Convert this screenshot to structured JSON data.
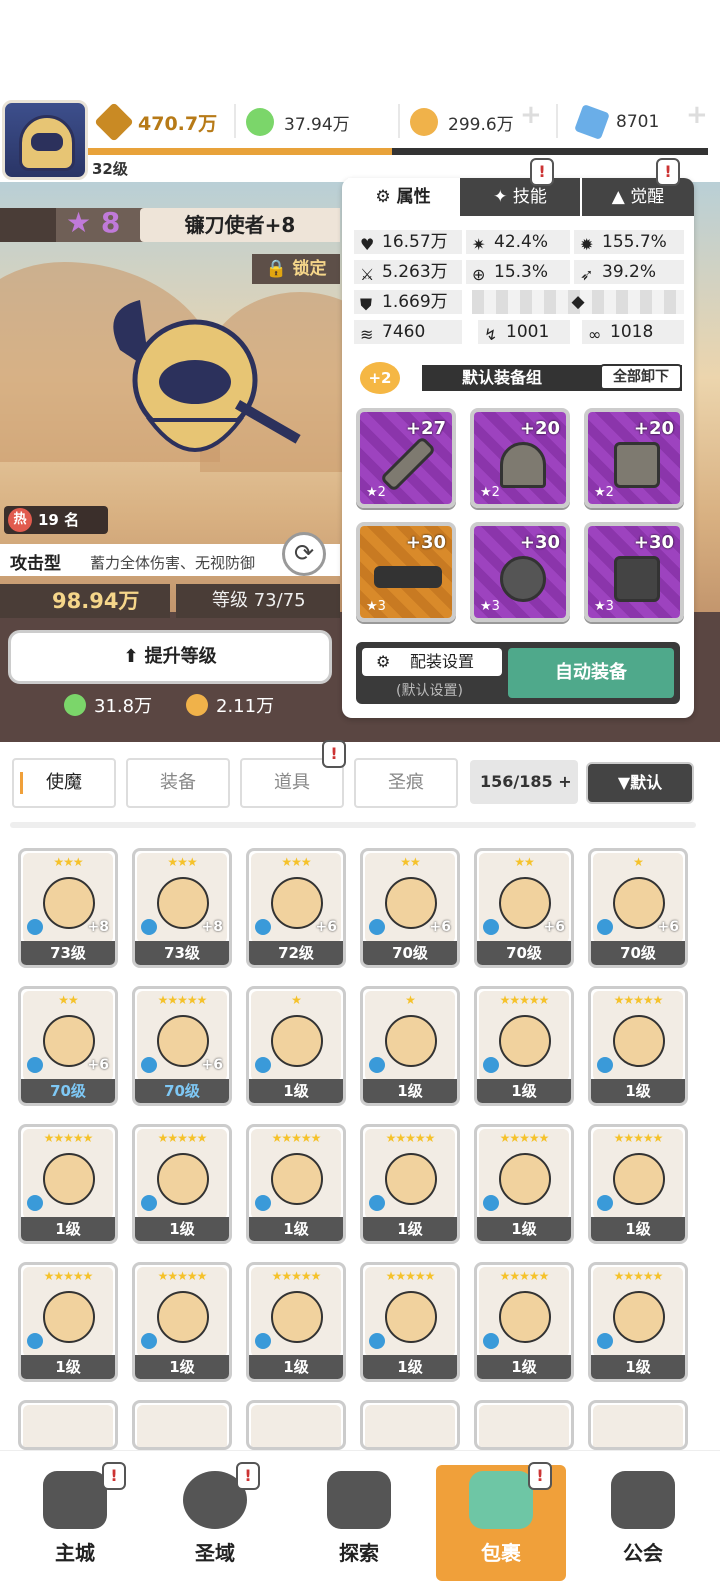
{
  "header": {
    "player_level": "32级",
    "xp_progress": 0.49,
    "resources": [
      {
        "icon": "sword-power-icon",
        "value": "470.7万",
        "color": "#c98a24"
      },
      {
        "icon": "green-orb-icon",
        "value": "37.94万",
        "color": "#7bd66a"
      },
      {
        "icon": "gold-coin-icon",
        "value": "299.6万",
        "color": "#f0b24a"
      },
      {
        "icon": "blue-gem-icon",
        "value": "8701",
        "color": "#6aaee8"
      }
    ]
  },
  "character": {
    "stars": "8",
    "name": "镰刀使者+8",
    "lock_label": "锁定",
    "heat_badge": "热",
    "heat_rank": "19 名",
    "type_label": "攻击型",
    "type_desc": "蓄力全体伤害、无视防御",
    "power": "98.94万",
    "level_text": "等级 73/75",
    "upgrade_label": "提升等级",
    "cost_green": "31.8万",
    "cost_gold": "2.11万"
  },
  "panel": {
    "tabs": [
      {
        "label": "属性",
        "icon": "attribute-icon"
      },
      {
        "label": "技能",
        "icon": "skill-icon"
      },
      {
        "label": "觉醒",
        "icon": "awaken-icon"
      }
    ],
    "stats": [
      {
        "icon": "heart-icon",
        "value": "16.57万"
      },
      {
        "icon": "crit-icon",
        "value": "42.4%"
      },
      {
        "icon": "burst-icon",
        "value": "155.7%"
      },
      {
        "icon": "attack-icon",
        "value": "5.263万"
      },
      {
        "icon": "accuracy-icon",
        "value": "15.3%"
      },
      {
        "icon": "dodge-icon",
        "value": "39.2%"
      },
      {
        "icon": "defense-icon",
        "value": "1.669万"
      },
      {
        "icon": "speed-icon",
        "value": "7460"
      },
      {
        "icon": "pierce-icon",
        "value": "1001"
      },
      {
        "icon": "resist-icon",
        "value": "1018"
      }
    ],
    "equip_badge": "+2",
    "equip_set": "默认装备组",
    "unload_all": "全部卸下",
    "equipment": [
      {
        "plus": "+27",
        "stars": "★2",
        "icon": "sword-item-icon",
        "color": "#9d43bf"
      },
      {
        "plus": "+20",
        "stars": "★2",
        "icon": "helmet-item-icon",
        "color": "#9d43bf"
      },
      {
        "plus": "+20",
        "stars": "★2",
        "icon": "armor-item-icon",
        "color": "#9d43bf"
      },
      {
        "plus": "+30",
        "stars": "★3",
        "icon": "belt-item-icon",
        "color": "#d98a2a"
      },
      {
        "plus": "+30",
        "stars": "★3",
        "icon": "necklace-item-icon",
        "color": "#9d43bf"
      },
      {
        "plus": "+30",
        "stars": "★3",
        "icon": "boots-item-icon",
        "color": "#9d43bf"
      }
    ],
    "config_label": "配装设置",
    "config_sub": "(默认设置)",
    "auto_equip": "自动装备"
  },
  "inventory": {
    "tabs": [
      "使魔",
      "装备",
      "道具",
      "圣痕"
    ],
    "count": "156/185",
    "sort_label": "▼默认",
    "cards": [
      {
        "level": "73级",
        "plus": "+8",
        "stars": "★★★",
        "blue": false
      },
      {
        "level": "73级",
        "plus": "+8",
        "stars": "★★★",
        "blue": false
      },
      {
        "level": "72级",
        "plus": "+6",
        "stars": "★★★",
        "blue": false
      },
      {
        "level": "70级",
        "plus": "+6",
        "stars": "★★",
        "blue": false
      },
      {
        "level": "70级",
        "plus": "+6",
        "stars": "★★",
        "blue": false
      },
      {
        "level": "70级",
        "plus": "+6",
        "stars": "★",
        "blue": false
      },
      {
        "level": "70级",
        "plus": "+6",
        "stars": "★★",
        "blue": true
      },
      {
        "level": "70级",
        "plus": "+6",
        "stars": "★★★★★",
        "blue": true
      },
      {
        "level": "1级",
        "plus": "",
        "stars": "★",
        "blue": false
      },
      {
        "level": "1级",
        "plus": "",
        "stars": "★",
        "blue": false
      },
      {
        "level": "1级",
        "plus": "",
        "stars": "★★★★★",
        "blue": false
      },
      {
        "level": "1级",
        "plus": "",
        "stars": "★★★★★",
        "blue": false
      },
      {
        "level": "1级",
        "plus": "",
        "stars": "★★★★★",
        "blue": false
      },
      {
        "level": "1级",
        "plus": "",
        "stars": "★★★★★",
        "blue": false
      },
      {
        "level": "1级",
        "plus": "",
        "stars": "★★★★★",
        "blue": false
      },
      {
        "level": "1级",
        "plus": "",
        "stars": "★★★★★",
        "blue": false
      },
      {
        "level": "1级",
        "plus": "",
        "stars": "★★★★★",
        "blue": false
      },
      {
        "level": "1级",
        "plus": "",
        "stars": "★★★★★",
        "blue": false
      },
      {
        "level": "1级",
        "plus": "",
        "stars": "★★★★★",
        "blue": false
      },
      {
        "level": "1级",
        "plus": "",
        "stars": "★★★★★",
        "blue": false
      },
      {
        "level": "1级",
        "plus": "",
        "stars": "★★★★★",
        "blue": false
      },
      {
        "level": "1级",
        "plus": "",
        "stars": "★★★★★",
        "blue": false
      },
      {
        "level": "1级",
        "plus": "",
        "stars": "★★★★★",
        "blue": false
      },
      {
        "level": "1级",
        "plus": "",
        "stars": "★★★★★",
        "blue": false
      }
    ]
  },
  "nav": [
    {
      "label": "主城",
      "icon": "castle-icon"
    },
    {
      "label": "圣域",
      "icon": "portal-icon"
    },
    {
      "label": "探索",
      "icon": "explore-sword-icon"
    },
    {
      "label": "包裹",
      "icon": "bag-icon"
    },
    {
      "label": "公会",
      "icon": "guild-icon"
    }
  ]
}
